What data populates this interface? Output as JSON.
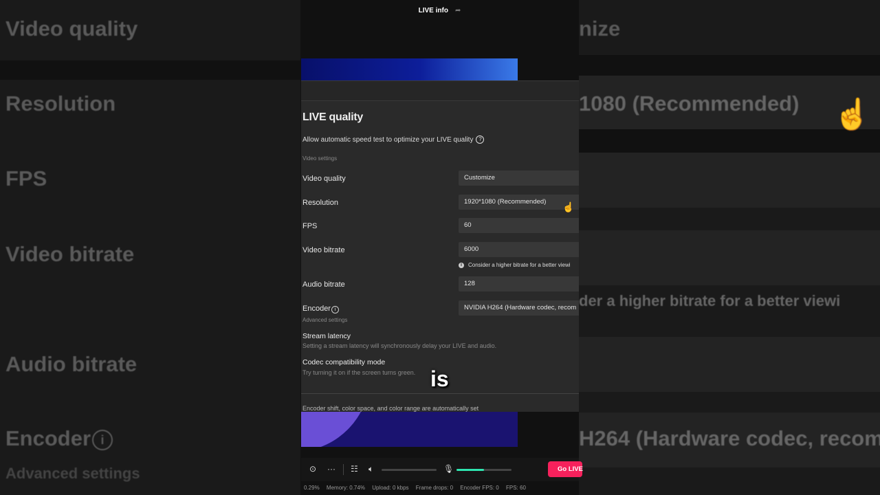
{
  "background_left": {
    "video_quality": "Video quality",
    "resolution": "Resolution",
    "fps": "FPS",
    "video_bitrate": "Video bitrate",
    "audio_bitrate": "Audio bitrate",
    "encoder": "Encoder",
    "advanced": "Advanced settings"
  },
  "background_right": {
    "customize": "nize",
    "resolution_value": "1080 (Recommended)",
    "hint": "der a higher bitrate for a better viewi",
    "encoder_value": "H264 (Hardware codec, recom"
  },
  "header": {
    "title": "LIVE info"
  },
  "dialog": {
    "title": "LIVE quality",
    "speed_test": "Allow automatic speed test to optimize your LIVE quality",
    "video_settings_label": "Video settings",
    "rows": {
      "video_quality": {
        "label": "Video quality",
        "value": "Customize"
      },
      "resolution": {
        "label": "Resolution",
        "value": "1920*1080 (Recommended)"
      },
      "fps": {
        "label": "FPS",
        "value": "60"
      },
      "video_bitrate": {
        "label": "Video bitrate",
        "value": "6000"
      },
      "audio_bitrate": {
        "label": "Audio bitrate",
        "value": "128"
      },
      "encoder": {
        "label": "Encoder",
        "value": "NVIDIA H264 (Hardware codec, recom"
      }
    },
    "bitrate_hint": "Consider a higher bitrate for a better viewi",
    "advanced_label": "Advanced settings",
    "stream_latency": {
      "title": "Stream latency",
      "desc": "Setting a stream latency will synchronously delay your LIVE and audio."
    },
    "codec_mode": {
      "title": "Codec compatibility mode",
      "desc": "Try turning it on if the screen turns green."
    },
    "cut_off_text": "Encoder shift, color space, and color range are automatically set"
  },
  "caption": "is",
  "toolbar": {
    "go_live": "Go LIVE",
    "volume_level": 0,
    "mic_level": 0.5
  },
  "status": {
    "cpu": "0.29%",
    "memory": "Memory: 0.74%",
    "upload": "Upload: 0 kbps",
    "frame_drops": "Frame drops: 0",
    "encoder_fps": "Encoder FPS: 0",
    "fps": "FPS: 60"
  }
}
